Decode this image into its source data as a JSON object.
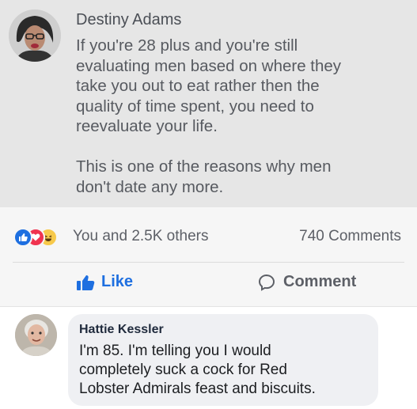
{
  "post": {
    "author": "Destiny Adams",
    "body": "If you're 28 plus and you're still\nevaluating men based on where they\ntake you out to eat rather then the\nquality of time spent, you need to\nreevaluate your life.\n\nThis is one of the reasons why men\ndon't date any more.",
    "avatar_icon": "profile-photo"
  },
  "reactions": {
    "icons": [
      "like-reaction-icon",
      "love-reaction-icon",
      "haha-reaction-icon"
    ],
    "summary": "You and 2.5K others",
    "comments_count": "740 Comments"
  },
  "actions": {
    "like_label": "Like",
    "comment_label": "Comment"
  },
  "comment": {
    "author": "Hattie Kessler",
    "text": "I'm 85. I'm telling you I would\ncompletely suck a cock for Red\nLobster Admirals feast and biscuits.",
    "avatar_icon": "profile-photo"
  },
  "colors": {
    "accent": "#1e6fe0",
    "love": "#f0334f",
    "haha": "#f7c94a"
  }
}
